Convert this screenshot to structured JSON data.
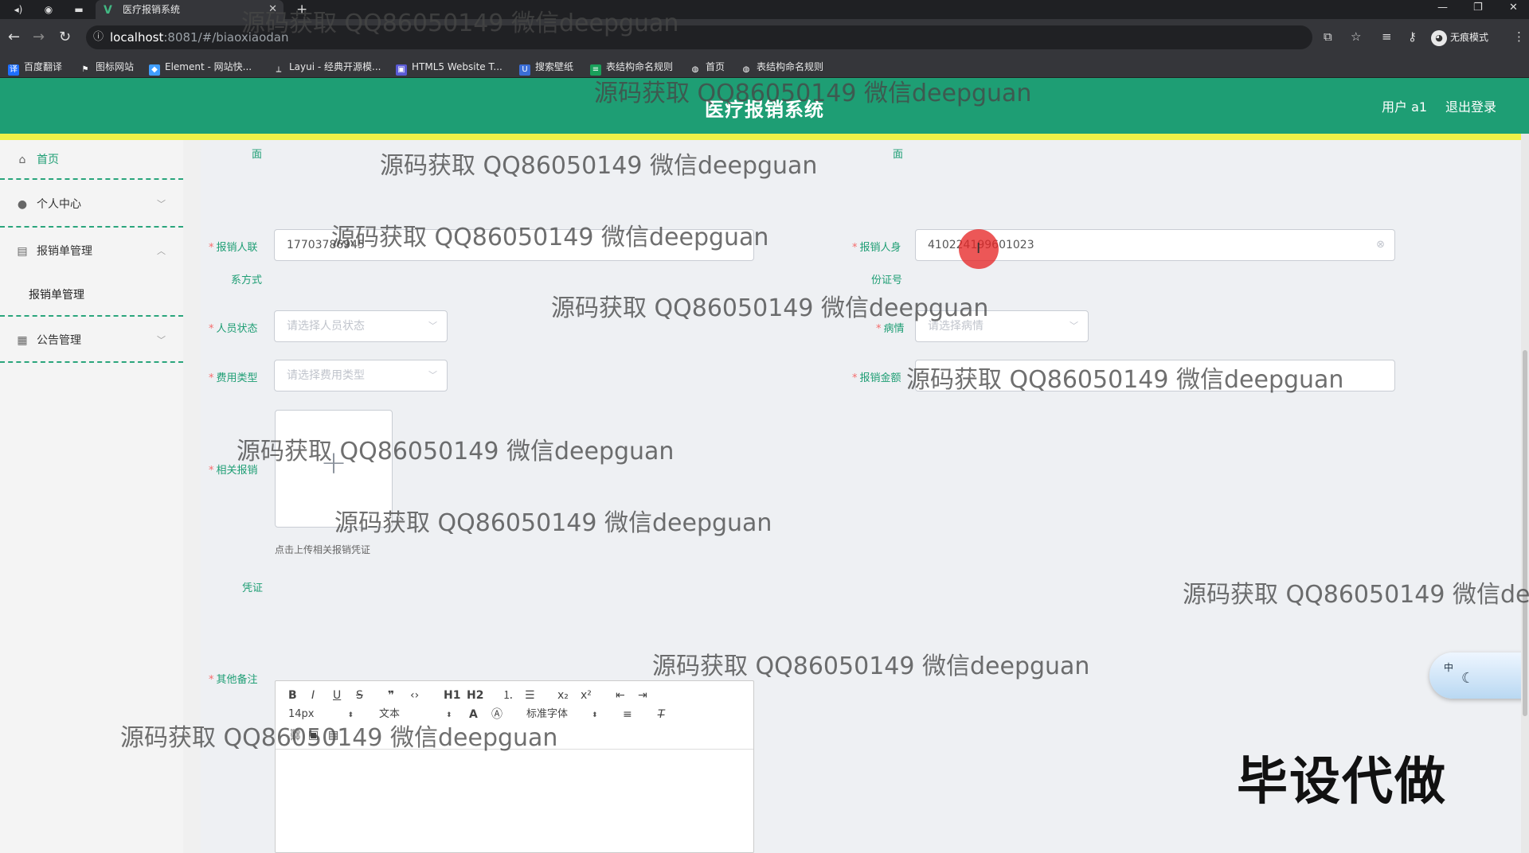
{
  "browser": {
    "tab_title": "医疗报销系统",
    "url_host": "localhost",
    "url_path": ":8081/#/biaoxiaodan",
    "incognito_label": "无痕模式",
    "bookmarks": [
      "百度翻译",
      "图标网站",
      "Element - 网站快...",
      "Layui - 经典开源模...",
      "HTML5 Website T...",
      "搜索壁纸",
      "表结构命名规则",
      "首页",
      "表结构命名规则"
    ]
  },
  "header": {
    "title": "医疗报销系统",
    "user_label": "用户 a1",
    "logout_label": "退出登录",
    "accent_color": "#1e9e74",
    "underline_color": "#f0f048"
  },
  "sidebar": {
    "items": [
      {
        "label": "首页",
        "icon": "home-icon"
      },
      {
        "label": "个人中心",
        "icon": "user-icon"
      },
      {
        "label": "报销单管理",
        "icon": "briefcase-icon"
      },
      {
        "label": "公告管理",
        "icon": "grid-icon"
      }
    ],
    "submenu_label": "报销单管理"
  },
  "form": {
    "top_left_fragment": "面",
    "top_right_fragment": "面",
    "phone_label_1": "报销人联",
    "phone_label_2": "系方式",
    "phone_value": "17703786945",
    "idcard_label_1": "报销人身",
    "idcard_label_2": "份证号",
    "idcard_value": "410224199601023",
    "status_label": "人员状态",
    "status_placeholder": "请选择人员状态",
    "illness_label": "病情",
    "illness_placeholder": "请选择病情",
    "fee_type_label": "费用类型",
    "fee_type_placeholder": "请选择费用类型",
    "amount_label": "报销金额",
    "amount_value": "",
    "voucher_label_1": "相关报销",
    "voucher_label_2": "凭证",
    "upload_tip": "点击上传相关报销凭证",
    "remark_label": "其他备注"
  },
  "editor": {
    "font_size": "14px",
    "paragraph": "文本",
    "font_family": "标准字体",
    "h1": "H1",
    "h2": "H2",
    "bold": "B",
    "italic": "I",
    "underline": "U",
    "strike": "S"
  },
  "ime": {
    "label": "中"
  },
  "watermarks": {
    "text": "源码获取 QQ86050149 微信deepguan",
    "partial": "源码获取 QQ86050149 微信dee",
    "prefix": "源码获取 QQ86050149 微信deepguan"
  },
  "stamp": "毕设代做"
}
